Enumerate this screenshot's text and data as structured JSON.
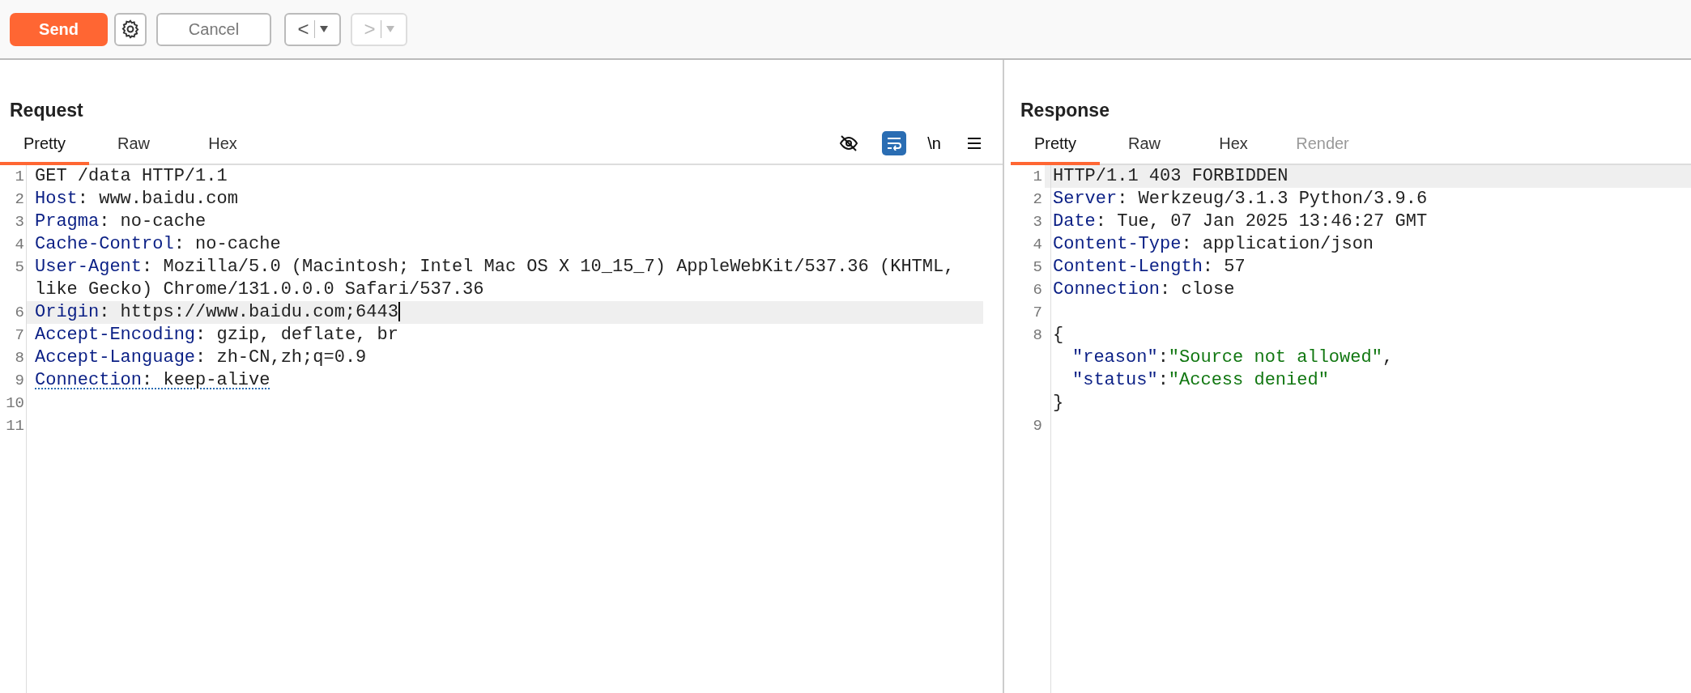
{
  "toolbar": {
    "send": "Send",
    "cancel": "Cancel",
    "back": {
      "label": "<",
      "disabled": false
    },
    "forward": {
      "label": ">",
      "disabled": true
    }
  },
  "request": {
    "title": "Request",
    "tabs": [
      {
        "label": "Pretty",
        "selected": true,
        "disabled": false
      },
      {
        "label": "Raw",
        "selected": false,
        "disabled": false
      },
      {
        "label": "Hex",
        "selected": false,
        "disabled": false
      }
    ],
    "tools": {
      "hide_toggle": false,
      "wrap_toggle": true,
      "newline_label": "\\n"
    },
    "rows": [
      {
        "number": "1",
        "current": false,
        "segments": [
          {
            "kind": "text",
            "text": "GET /data HTTP/1.1"
          }
        ]
      },
      {
        "number": "2",
        "current": false,
        "segments": [
          {
            "kind": "key",
            "text": "Host"
          },
          {
            "kind": "text",
            "text": ": www.baidu.com"
          }
        ]
      },
      {
        "number": "3",
        "current": false,
        "segments": [
          {
            "kind": "key",
            "text": "Pragma"
          },
          {
            "kind": "text",
            "text": ": no-cache"
          }
        ]
      },
      {
        "number": "4",
        "current": false,
        "segments": [
          {
            "kind": "key",
            "text": "Cache-Control"
          },
          {
            "kind": "text",
            "text": ": no-cache"
          }
        ]
      },
      {
        "number": "5",
        "current": false,
        "segments": [
          {
            "kind": "key",
            "text": "User-Agent"
          },
          {
            "kind": "text",
            "text": ": Mozilla/5.0 (Macintosh; Intel Mac OS X 10_15_7) AppleWebKit/537.36 (KHTML, like Gecko) Chrome/131.0.0.0 Safari/537.36"
          }
        ]
      },
      {
        "number": "6",
        "current": true,
        "segments": [
          {
            "kind": "key",
            "text": "Origin"
          },
          {
            "kind": "text",
            "text": ": https://www.baidu.com;6443"
          }
        ]
      },
      {
        "number": "7",
        "current": false,
        "segments": [
          {
            "kind": "key",
            "text": "Accept-Encoding"
          },
          {
            "kind": "text",
            "text": ": gzip, deflate, br"
          }
        ]
      },
      {
        "number": "8",
        "current": false,
        "segments": [
          {
            "kind": "key",
            "text": "Accept-Language"
          },
          {
            "kind": "text",
            "text": ": zh-CN,zh;q=0.9"
          }
        ]
      },
      {
        "number": "9",
        "current": false,
        "underlined": true,
        "segments": [
          {
            "kind": "key",
            "text": "Connection"
          },
          {
            "kind": "text",
            "text": ": keep-alive"
          }
        ]
      },
      {
        "number": "10",
        "current": false,
        "segments": []
      },
      {
        "number": "11",
        "current": false,
        "segments": []
      }
    ]
  },
  "response": {
    "title": "Response",
    "tabs": [
      {
        "label": "Pretty",
        "selected": true,
        "disabled": false
      },
      {
        "label": "Raw",
        "selected": false,
        "disabled": false
      },
      {
        "label": "Hex",
        "selected": false,
        "disabled": false
      },
      {
        "label": "Render",
        "selected": false,
        "disabled": true
      }
    ],
    "rows": [
      {
        "number": "1",
        "current": true,
        "segments": [
          {
            "kind": "text",
            "text": "HTTP/1.1 403 FORBIDDEN"
          }
        ]
      },
      {
        "number": "2",
        "current": false,
        "segments": [
          {
            "kind": "key",
            "text": "Server"
          },
          {
            "kind": "text",
            "text": ": Werkzeug/3.1.3 Python/3.9.6"
          }
        ]
      },
      {
        "number": "3",
        "current": false,
        "segments": [
          {
            "kind": "key",
            "text": "Date"
          },
          {
            "kind": "text",
            "text": ": Tue, 07 Jan 2025 13:46:27 GMT"
          }
        ]
      },
      {
        "number": "4",
        "current": false,
        "segments": [
          {
            "kind": "key",
            "text": "Content-Type"
          },
          {
            "kind": "text",
            "text": ": application/json"
          }
        ]
      },
      {
        "number": "5",
        "current": false,
        "segments": [
          {
            "kind": "key",
            "text": "Content-Length"
          },
          {
            "kind": "text",
            "text": ": 57"
          }
        ]
      },
      {
        "number": "6",
        "current": false,
        "segments": [
          {
            "kind": "key",
            "text": "Connection"
          },
          {
            "kind": "text",
            "text": ": close"
          }
        ]
      },
      {
        "number": "7",
        "current": false,
        "segments": []
      },
      {
        "number": "8",
        "current": false,
        "segments": [
          {
            "kind": "text",
            "text": "{"
          }
        ]
      },
      {
        "current": false,
        "indented": true,
        "segments": [
          {
            "kind": "jkey",
            "text": "\"reason\""
          },
          {
            "kind": "text",
            "text": ":"
          },
          {
            "kind": "jstr",
            "text": "\"Source not allowed\""
          },
          {
            "kind": "text",
            "text": ","
          }
        ]
      },
      {
        "current": false,
        "indented": true,
        "segments": [
          {
            "kind": "jkey",
            "text": "\"status\""
          },
          {
            "kind": "text",
            "text": ":"
          },
          {
            "kind": "jstr",
            "text": "\"Access denied\""
          }
        ]
      },
      {
        "current": false,
        "segments": [
          {
            "kind": "text",
            "text": "}"
          }
        ]
      },
      {
        "number": "9",
        "current": false,
        "segments": []
      }
    ]
  }
}
